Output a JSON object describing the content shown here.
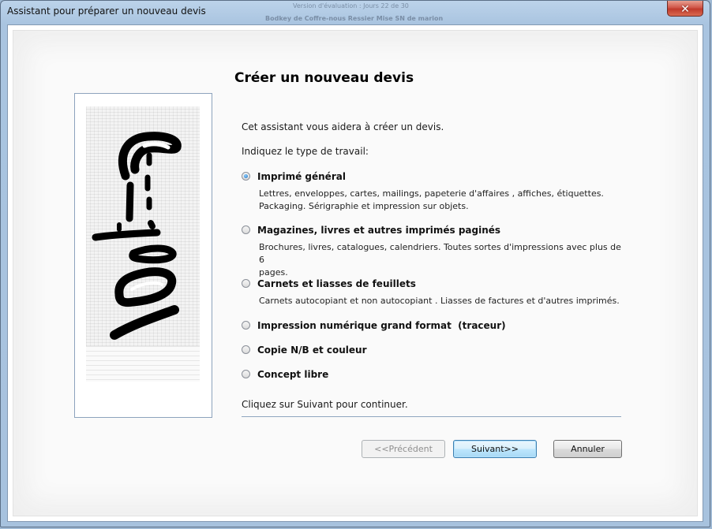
{
  "window": {
    "title": "Assistant pour préparer un nouveau devis",
    "close_label": "✕",
    "background_title_1": "Version d'évaluation : Jours 22 de 30",
    "background_title_2": "Bodkey de Coffre-nous Ressier Mise SN de marion"
  },
  "wizard": {
    "heading": "Créer un nouveau devis",
    "intro": "Cet assistant vous aidera à créer un devis.",
    "prompt": "Indiquez le type de travail:",
    "options": [
      {
        "label": "Imprimé général",
        "selected": true,
        "description_1": "Lettres, enveloppes, cartes, mailings, papeterie d'affaires , affiches, étiquettes.",
        "description_2": "Packaging. Sérigraphie et impression sur objets."
      },
      {
        "label": "Magazines, livres et autres imprimés paginés",
        "selected": false,
        "description_1": "Brochures, livres, catalogues, calendriers. Toutes sortes d'impressions avec plus de 6",
        "description_2": "pages."
      },
      {
        "label": "Carnets et liasses de feuillets",
        "selected": false,
        "description_1": "Carnets autocopiant et non autocopiant . Liasses de factures et d'autres imprimés.",
        "description_2": ""
      },
      {
        "label": "Impression numérique grand format  (traceur)",
        "selected": false
      },
      {
        "label": "Copie N/B et couleur",
        "selected": false
      },
      {
        "label": "Concept libre",
        "selected": false
      }
    ],
    "footer_hint": "Cliquez sur Suivant pour continuer."
  },
  "buttons": {
    "previous": "<<Précédent",
    "next": "Suivant>>",
    "cancel": "Annuler"
  },
  "icons": {
    "side_image": "calligraphy-symbol-icon",
    "close": "close-icon"
  }
}
